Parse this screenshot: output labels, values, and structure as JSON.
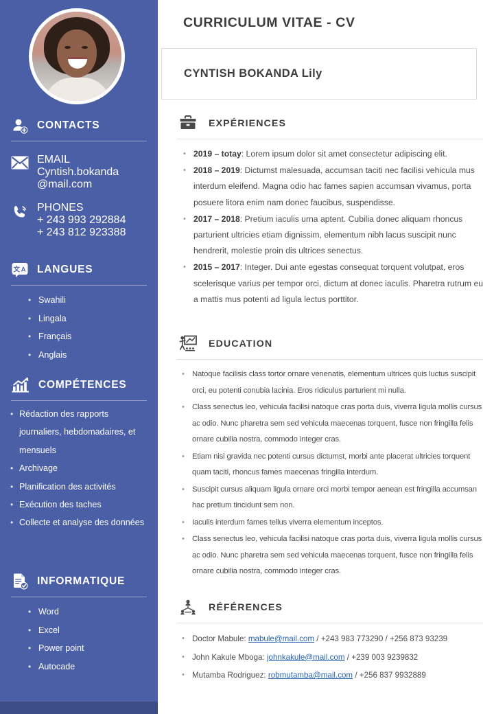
{
  "colors": {
    "sidebar_bg": "#4a5fa5",
    "sidebar_footer": "#3c4d86",
    "link": "#2a63b0",
    "text": "#4c4c4c",
    "heading": "#3d3d3d"
  },
  "sidebar": {
    "avatar_alt": "portrait-photo",
    "sections": [
      {
        "id": "contacts",
        "icon": "user-add-icon",
        "title": "CONTACTS",
        "entries": [
          {
            "icon": "envelope-icon",
            "label": "EMAIL",
            "values": [
              "Cyntish.bokanda  @mail.com"
            ]
          },
          {
            "icon": "phone-icon",
            "label": "PHONES",
            "values": [
              "+ 243 993 292884",
              "+ 243 812 923388"
            ]
          }
        ]
      },
      {
        "id": "langues",
        "icon": "translate-icon",
        "title": "LANGUES",
        "items": [
          "Swahili",
          "Lingala",
          "Français",
          "Anglais"
        ]
      },
      {
        "id": "competences",
        "icon": "chart-growth-icon",
        "title": "COMPÉTENCES",
        "items": [
          "Rédaction des rapports journaliers, hebdomadaires, et mensuels",
          "Archivage",
          "Planification des activités",
          "Exécution des taches",
          "Collecte et analyse des données"
        ]
      },
      {
        "id": "informatique",
        "icon": "document-check-icon",
        "title": "INFORMATIQUE",
        "items": [
          "Word",
          "Excel",
          "Power point",
          "Autocade"
        ]
      }
    ]
  },
  "main": {
    "cv_title": "CURRICULUM VITAE - CV",
    "full_name": "CYNTISH BOKANDA Lily",
    "experiences": {
      "icon": "briefcase-icon",
      "title": "EXPÉRIENCES",
      "items": [
        {
          "period": "2019 – totay",
          "text": ": Lorem ipsum dolor  sit amet consectetur adipiscing elit."
        },
        {
          "period": "2018 – 2019",
          "text": ": Dictumst malesuada, accumsan taciti nec facilisi vehicula mus interdum eleifend. Magna odio hac fames sapien accumsan vivamus, porta posuere  litora enim nam donec faucibus,  suspendisse."
        },
        {
          "period": "2017 – 2018",
          "text": ": Pretium iaculis urna aptent. Cubilia donec aliquam rhoncus parturient ultricies etiam dignissim,  elementum  nibh  lacus suscipit nunc hendrerit, molestie proin dis  ultrices senectus."
        },
        {
          "period": "2015 – 2017",
          "text": ": Integer. Dui ante egestas consequat  torquent volutpat, eros scelerisque  varius per tempor orci, dictum at donec iaculis. Pharetra rutrum eu a mattis mus potenti ad ligula lectus porttitor."
        }
      ]
    },
    "education": {
      "icon": "teacher-board-icon",
      "title": "EDUCATION",
      "items": [
        "Natoque  facilisis class tortor ornare venenatis, elementum  ultrices quis luctus suscipit orci, eu potenti conubia lacinia. Eros ridiculus parturient mi nulla.",
        "Class senectus leo, vehicula facilisi natoque cras porta duis, viverra ligula mollis cursus ac odio. Nunc pharetra sem  sed vehicula maecenas torquent,  fusce non fringilla felis ornare cubilia nostra, commodo integer  cras.",
        "Etiam nisi gravida nec potenti cursus dictumst, morbi ante placerat ultricies torquent quam taciti, rhoncus fames maecenas fringilla interdum.",
        "Suscipit cursus aliquam ligula ornare orci morbi tempor aenean est fringilla accumsan hac pretium tincidunt sem non.",
        "Iaculis interdum fames tellus viverra elementum  inceptos.",
        "Class senectus leo, vehicula facilisi natoque cras porta duis, viverra ligula mollis cursus ac odio. Nunc pharetra sem  sed vehicula maecenas torquent,  fusce non fringilla felis ornare cubilia nostra, commodo integer  cras."
      ]
    },
    "references": {
      "icon": "network-people-icon",
      "title": "RÉFÉRENCES",
      "items": [
        {
          "name": "Doctor Mabule:",
          "email": "mabule@mail.com",
          "phones": "/ +243 983 773290 / +256 873 93239"
        },
        {
          "name": "John Kakule Mboga:",
          "email": "johnkakule@mail.com",
          "phones": "/ +239 003 9239832"
        },
        {
          "name": "Mutamba Rodriguez:",
          "email": "robmutamba@mail.com",
          "phones": "/ +256 837 9932889"
        }
      ]
    }
  }
}
